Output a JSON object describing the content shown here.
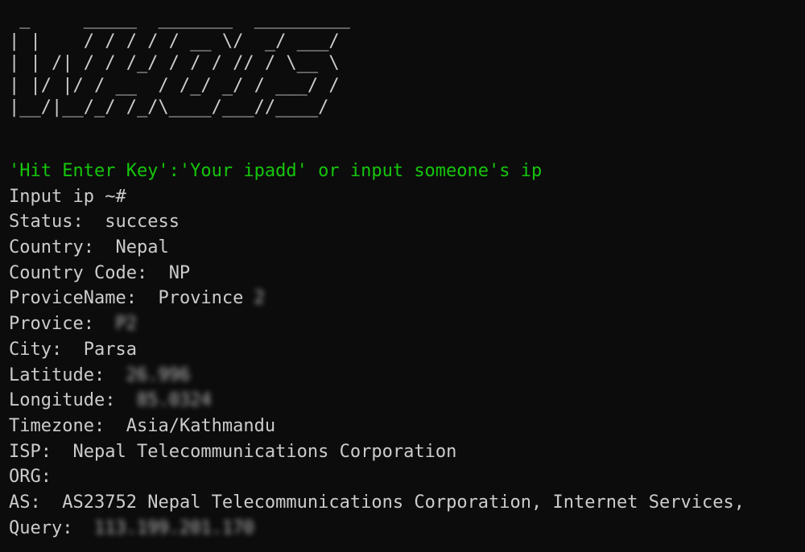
{
  "banner": {
    "lines": [
      " _     _____  _______  _________ ",
      "| |    / / / / / __ \\/  _/ ___/",
      "| | /| / / /_/ / / / // / \\__ \\ ",
      "| |/ |/ / __  / /_/ _/ / ___/ / ",
      "|__/|__/_/ /_/\\____/___//____/  "
    ]
  },
  "hint": "'Hit Enter Key':'Your ipadd' or input someone's ip",
  "prompt": "Input ip ~#",
  "results": {
    "status_label": "Status:",
    "status_value": "success",
    "country_label": "Country:",
    "country_value": "Nepal",
    "country_code_label": "Country Code:",
    "country_code_value": "NP",
    "province_name_label": "ProviceName:",
    "province_name_value": "Province",
    "province_name_redacted": "2",
    "province_label": "Provice:",
    "province_redacted": "P2",
    "city_label": "City:",
    "city_value": "Parsa",
    "latitude_label": "Latitude:",
    "latitude_redacted": "26.996",
    "longitude_label": "Longitude:",
    "longitude_redacted": "85.0324",
    "timezone_label": "Timezone:",
    "timezone_value": "Asia/Kathmandu",
    "isp_label": "ISP:",
    "isp_value": "Nepal Telecommunications Corporation",
    "org_label": "ORG:",
    "as_label": "AS:",
    "as_value": "AS23752 Nepal Telecommunications Corporation, Internet Services,",
    "query_label": "Query:",
    "query_redacted": "113.199.201.170"
  },
  "colors": {
    "background": "#0c0c0c",
    "text": "#cccccc",
    "hint": "#16c60c"
  }
}
